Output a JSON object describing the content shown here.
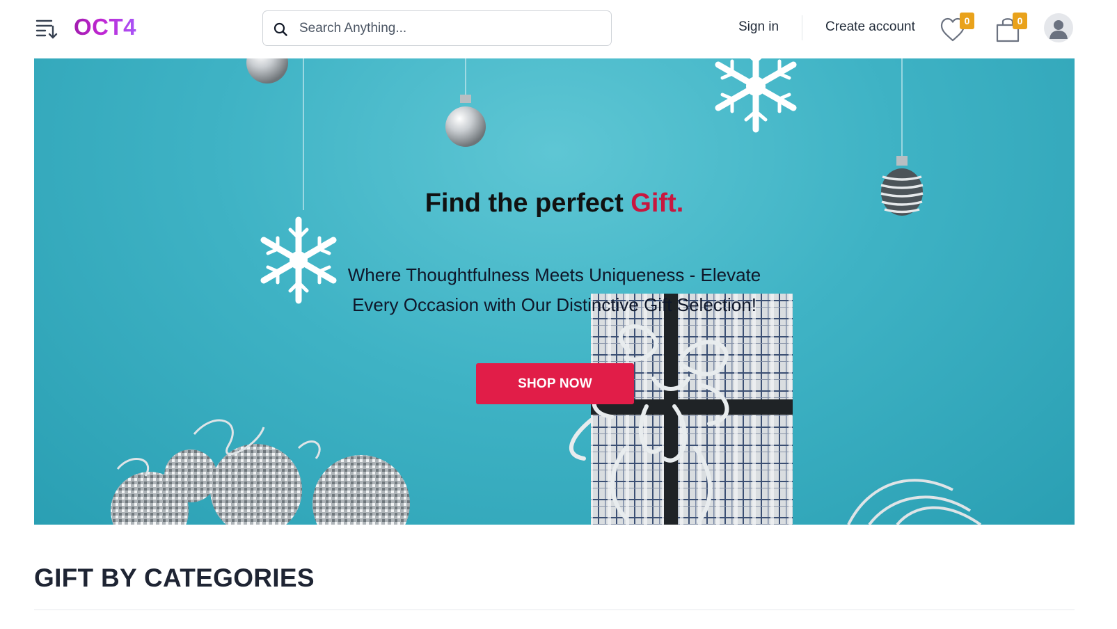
{
  "header": {
    "logo_text": "OCT4",
    "search_placeholder": "Search Anything...",
    "sign_in_label": "Sign in",
    "create_account_label": "Create account",
    "wishlist_count": "0",
    "cart_count": "0",
    "icons": {
      "menu": "sort-menu-icon",
      "search": "search-icon",
      "wishlist": "heart-icon",
      "cart": "shopping-bag-icon",
      "account": "user-avatar-icon"
    }
  },
  "hero": {
    "title_main": "Find the perfect",
    "title_accent": "Gift.",
    "subtitle": "Where Thoughtfulness Meets Uniqueness - Elevate Every Occasion with Our Distinctive Gift Selection!",
    "cta_label": "SHOP NOW"
  },
  "section": {
    "title": "GIFT BY CATEGORIES"
  },
  "colors": {
    "accent": "#e11d48",
    "badge": "#e9a21b",
    "hero_bg": "#3fb3c5",
    "logo": "#c026d3"
  }
}
